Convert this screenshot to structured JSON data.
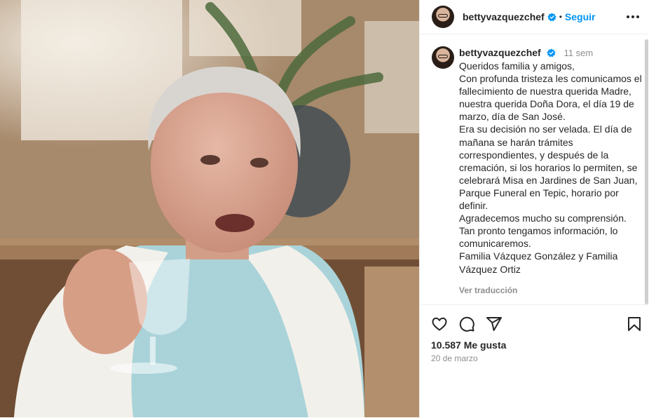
{
  "post": {
    "username": "bettyvazquezchef",
    "follow_label": "Seguir",
    "header_separator": "•",
    "caption": {
      "time_ago": "11 sem",
      "text": "Queridos familia y amigos,\nCon profunda tristeza les comunicamos el fallecimiento de nuestra querida Madre, nuestra querida Doña Dora, el día 19 de marzo, día de San José.\nEra su decisión no ser velada. El día de mañana se harán trámites correspondientes, y después de la cremación, si los horarios lo permiten, se celebrará Misa en Jardines de San Juan, Parque Funeral en Tepic, horario por definir.\nAgradecemos mucho su comprensión.\nTan pronto tengamos información, lo comunicaremos.\nFamilia Vázquez González y Familia Vázquez Ortiz",
      "translate_label": "Ver traducción"
    },
    "likes": "10.587 Me gusta",
    "date": "20 de marzo"
  },
  "icons": {
    "verified": "verified-badge-icon",
    "more": "more-options-icon",
    "like": "heart-icon",
    "comment": "comment-icon",
    "share": "send-icon",
    "save": "bookmark-icon"
  },
  "colors": {
    "accent": "#0095f6",
    "text": "#262626",
    "muted": "#8e8e8e",
    "border": "#efefef"
  }
}
